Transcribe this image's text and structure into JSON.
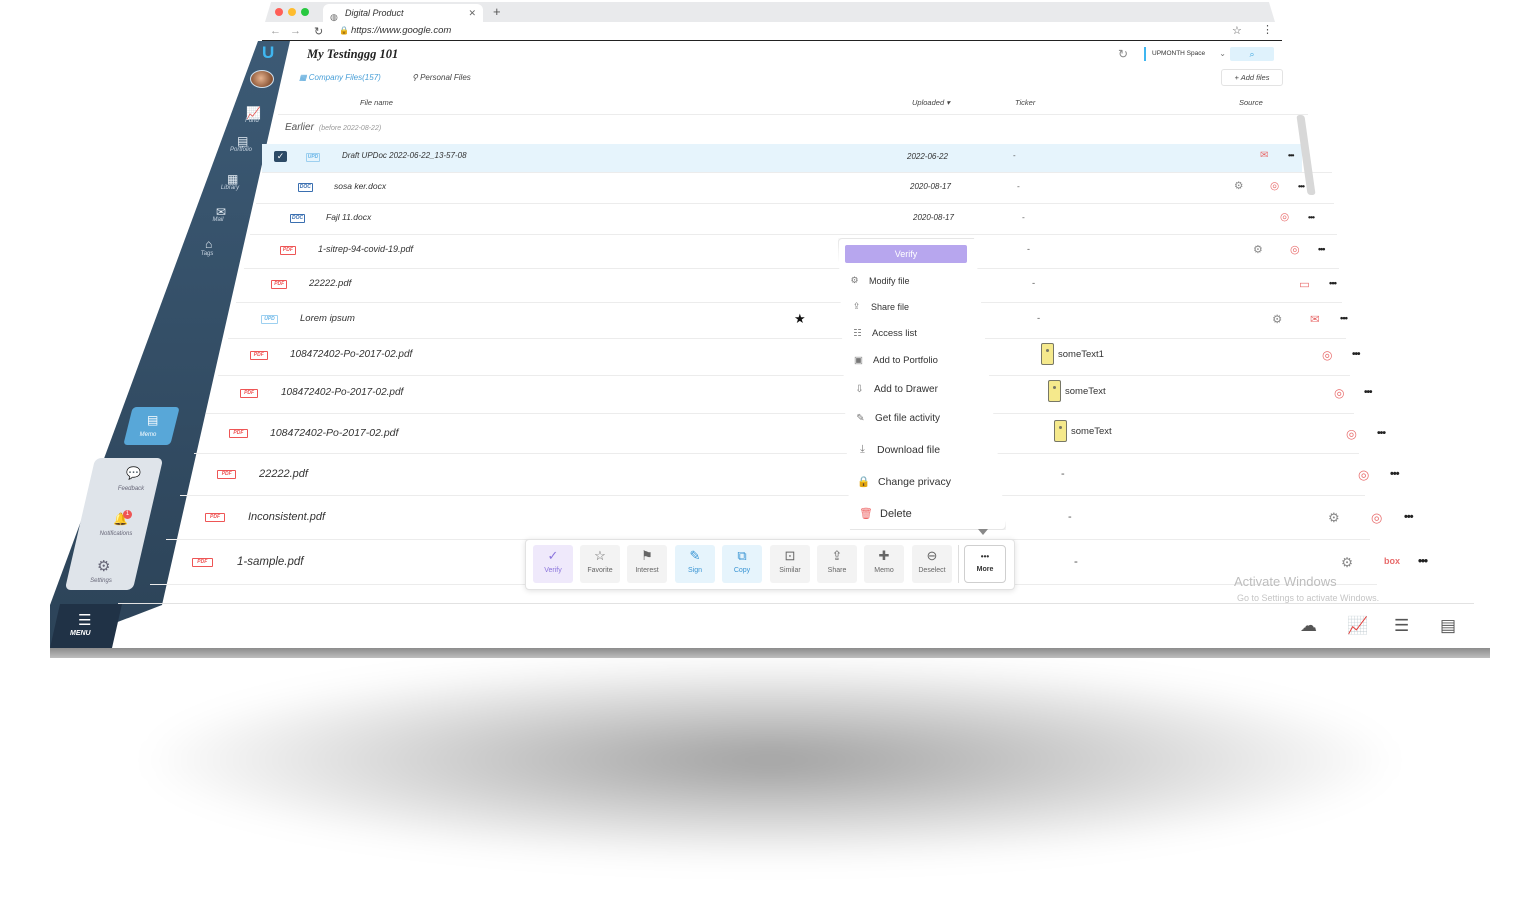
{
  "browser": {
    "tab_title": "Digital Product",
    "tab_close": "✕",
    "new_tab": "+",
    "url": "https://www.google.com",
    "window_dots": [
      "#ff5f57",
      "#febc2e",
      "#28c840"
    ]
  },
  "sidebar": {
    "items": [
      {
        "label": "Fund",
        "icon": "chart-icon"
      },
      {
        "label": "Portfolio",
        "icon": "portfolio-icon"
      },
      {
        "label": "Library",
        "icon": "library-icon"
      },
      {
        "label": "Mail",
        "icon": "mail-icon"
      },
      {
        "label": "Tags",
        "icon": "tag-icon"
      }
    ],
    "memo_label": "Memo",
    "feedback_label": "Feedback",
    "notifications_label": "Notifications",
    "notifications_badge": "1",
    "settings_label": "Settings",
    "menu_label": "MENU"
  },
  "header": {
    "title": "My Testinggg 101",
    "space_selector": "UPMONTH Space",
    "tab_company": "Company Files(157)",
    "tab_personal": "Personal Files",
    "add_files": "+ Add files"
  },
  "columns": {
    "file_name": "File name",
    "uploaded": "Uploaded ▾",
    "ticker": "Ticker",
    "source": "Source"
  },
  "group": {
    "label": "Earlier",
    "sub": "(before 2022-08-22)"
  },
  "files": [
    {
      "type": "UPD",
      "name": "Draft UPDoc 2022-06-22_13-57-08",
      "date": "2022-06-22",
      "ticker": "-"
    },
    {
      "type": "DOC",
      "name": "sosa ker.docx",
      "date": "2020-08-17",
      "ticker": "-"
    },
    {
      "type": "DOC",
      "name": "Fajl 11.docx",
      "date": "2020-08-17",
      "ticker": "-"
    },
    {
      "type": "PDF",
      "name": "1-sitrep-94-covid-19.pdf",
      "date": "",
      "ticker": "-"
    },
    {
      "type": "PDF",
      "name": "22222.pdf",
      "date": "",
      "ticker": "-"
    },
    {
      "type": "UPD",
      "name": "Lorem ipsum",
      "date": "",
      "ticker": "-"
    },
    {
      "type": "PDF",
      "name": "108472402-Po-2017-02.pdf",
      "date": "",
      "ticker": "someText1"
    },
    {
      "type": "PDF",
      "name": "108472402-Po-2017-02.pdf",
      "date": "",
      "ticker": "someText"
    },
    {
      "type": "PDF",
      "name": "108472402-Po-2017-02.pdf",
      "date": "",
      "ticker": "someText"
    },
    {
      "type": "PDF",
      "name": "22222.pdf",
      "date": "",
      "ticker": "-"
    },
    {
      "type": "PDF",
      "name": "Inconsistent.pdf",
      "date": "",
      "ticker": "-"
    },
    {
      "type": "PDF",
      "name": "1-sample.pdf",
      "date": "",
      "ticker": "-"
    }
  ],
  "source_box_label": "box",
  "row_menu": "•••",
  "context_menu": {
    "verify": "Verify",
    "items": [
      {
        "label": "Modify file",
        "icon": "gear-icon"
      },
      {
        "label": "Share file",
        "icon": "share-icon"
      },
      {
        "label": "Access list",
        "icon": "users-icon"
      },
      {
        "label": "Add to Portfolio",
        "icon": "portfolio-icon"
      },
      {
        "label": "Add to Drawer",
        "icon": "drawer-icon"
      },
      {
        "label": "Get file activity",
        "icon": "activity-icon"
      },
      {
        "label": "Download file",
        "icon": "download-icon"
      },
      {
        "label": "Change privacy",
        "icon": "lock-icon"
      },
      {
        "label": "Delete",
        "icon": "trash-icon"
      }
    ]
  },
  "toolbar": {
    "buttons": [
      {
        "label": "Verify",
        "icon": "check-circle-icon"
      },
      {
        "label": "Favorite",
        "icon": "star-icon"
      },
      {
        "label": "Interest",
        "icon": "flag-icon"
      },
      {
        "label": "Sign",
        "icon": "pen-icon"
      },
      {
        "label": "Copy",
        "icon": "copy-icon"
      },
      {
        "label": "Similar",
        "icon": "similar-icon"
      },
      {
        "label": "Share",
        "icon": "share-icon"
      },
      {
        "label": "Memo",
        "icon": "memo-icon"
      },
      {
        "label": "Deselect",
        "icon": "minus-circle-icon"
      }
    ],
    "more_label": "More",
    "more_dots": "•••"
  },
  "watermark": {
    "line1": "Activate Windows",
    "line2": "Go to Settings to activate Windows."
  },
  "colors": {
    "sidebar": "#34506a",
    "accent": "#3fb6f0",
    "verify": "#b7a6ee",
    "selected_row": "#e6f4fc",
    "danger": "#e55555"
  }
}
